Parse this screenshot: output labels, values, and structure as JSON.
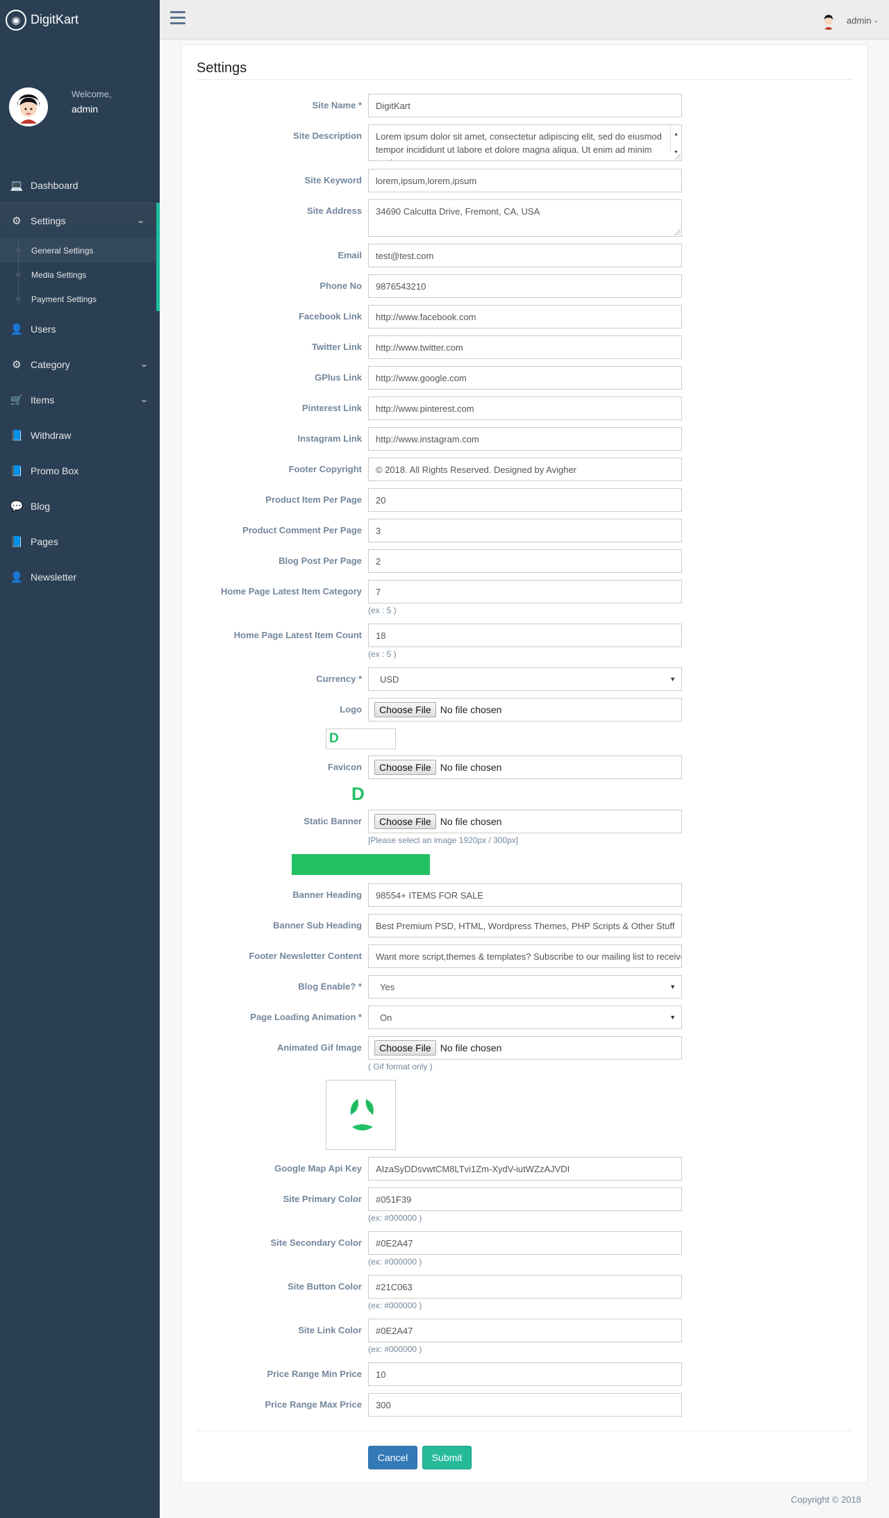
{
  "brand": {
    "name": "DigitKart"
  },
  "profile": {
    "welcome": "Welcome,",
    "username": "admin"
  },
  "sidebar": {
    "items": [
      {
        "label": "Dashboard",
        "icon": "laptop-icon"
      },
      {
        "label": "Settings",
        "icon": "gear-icon"
      },
      {
        "label": "Users",
        "icon": "user-icon"
      },
      {
        "label": "Category",
        "icon": "gear-icon"
      },
      {
        "label": "Items",
        "icon": "cart-icon"
      },
      {
        "label": "Withdraw",
        "icon": "book-icon"
      },
      {
        "label": "Promo Box",
        "icon": "book-icon"
      },
      {
        "label": "Blog",
        "icon": "comments-icon"
      },
      {
        "label": "Pages",
        "icon": "book-icon"
      },
      {
        "label": "Newsletter",
        "icon": "user-icon"
      }
    ],
    "settings_sub": [
      {
        "label": "General Settings"
      },
      {
        "label": "Media Settings"
      },
      {
        "label": "Payment Settings"
      }
    ]
  },
  "topbar": {
    "user": "admin"
  },
  "page": {
    "title": "Settings"
  },
  "form": {
    "site_name": {
      "label": "Site Name *",
      "value": "DigitKart"
    },
    "site_description": {
      "label": "Site Description",
      "value": "Lorem ipsum dolor sit amet, consectetur adipiscing elit, sed do eiusmod tempor incididunt ut labore et dolore magna aliqua. Ut enim ad minim veniam"
    },
    "site_keyword": {
      "label": "Site Keyword",
      "value": "lorem,ipsum,lorem,ipsum"
    },
    "site_address": {
      "label": "Site Address",
      "value": "34690 Calcutta Drive, Fremont, CA, USA"
    },
    "email": {
      "label": "Email",
      "value": "test@test.com"
    },
    "phone": {
      "label": "Phone No",
      "value": "9876543210"
    },
    "facebook": {
      "label": "Facebook Link",
      "value": "http://www.facebook.com"
    },
    "twitter": {
      "label": "Twitter Link",
      "value": "http://www.twitter.com"
    },
    "gplus": {
      "label": "GPlus Link",
      "value": "http://www.google.com"
    },
    "pinterest": {
      "label": "Pinterest Link",
      "value": "http://www.pinterest.com"
    },
    "instagram": {
      "label": "Instagram Link",
      "value": "http://www.instagram.com"
    },
    "footer_copyright": {
      "label": "Footer Copyright",
      "value": "© 2018. All Rights Reserved. Designed by Avigher"
    },
    "product_per_page": {
      "label": "Product Item Per Page",
      "value": "20"
    },
    "product_comment_per_page": {
      "label": "Product Comment Per Page",
      "value": "3"
    },
    "blog_per_page": {
      "label": "Blog Post Per Page",
      "value": "2"
    },
    "home_latest_category": {
      "label": "Home Page Latest Item Category",
      "value": "7",
      "help": "(ex : 5 )"
    },
    "home_latest_count": {
      "label": "Home Page Latest Item Count",
      "value": "18",
      "help": "(ex : 5 )"
    },
    "currency": {
      "label": "Currency *",
      "value": "USD"
    },
    "logo": {
      "label": "Logo",
      "button": "Choose File",
      "status": "No file chosen",
      "preview_text": "D"
    },
    "favicon": {
      "label": "Favicon",
      "button": "Choose File",
      "status": "No file chosen",
      "preview_text": "D"
    },
    "static_banner": {
      "label": "Static Banner",
      "button": "Choose File",
      "status": "No file chosen",
      "help": "[Please select an image 1920px / 300px]"
    },
    "banner_heading": {
      "label": "Banner Heading",
      "value": "98554+ ITEMS FOR SALE"
    },
    "banner_sub_heading": {
      "label": "Banner Sub Heading",
      "value": "Best Premium PSD, HTML, Wordpress Themes, PHP Scripts & Other Stuff"
    },
    "footer_newsletter": {
      "label": "Footer Newsletter Content",
      "value": "Want more script,themes & templates? Subscribe to our mailing list to receive updates"
    },
    "blog_enable": {
      "label": "Blog Enable? *",
      "value": "Yes"
    },
    "page_loading": {
      "label": "Page Loading Animation *",
      "value": "On"
    },
    "animated_gif": {
      "label": "Animated Gif Image",
      "button": "Choose File",
      "status": "No file chosen",
      "help": "( Gif format only )"
    },
    "google_map_key": {
      "label": "Google Map Api Key",
      "value": "AIzaSyDDsvwtCM8LTvi1Zm-XydV-iutWZzAJVDI"
    },
    "primary_color": {
      "label": "Site Primary Color",
      "value": "#051F39",
      "help": "(ex: #000000 )"
    },
    "secondary_color": {
      "label": "Site Secondary Color",
      "value": "#0E2A47",
      "help": "(ex: #000000 )"
    },
    "button_color": {
      "label": "Site Button Color",
      "value": "#21C063",
      "help": "(ex: #000000 )"
    },
    "link_color": {
      "label": "Site Link Color",
      "value": "#0E2A47",
      "help": "(ex: #000000 )"
    },
    "price_min": {
      "label": "Price Range Min Price",
      "value": "10"
    },
    "price_max": {
      "label": "Price Range Max Price",
      "value": "300"
    }
  },
  "actions": {
    "cancel": "Cancel",
    "submit": "Submit"
  },
  "footer": {
    "copyright": "Copyright © 2018"
  },
  "colors": {
    "sidebar": "#2a3f54",
    "accent": "#1abb9c",
    "brand_green": "#21c063",
    "cancel_blue": "#337ab7",
    "submit_green": "#26b99a"
  }
}
